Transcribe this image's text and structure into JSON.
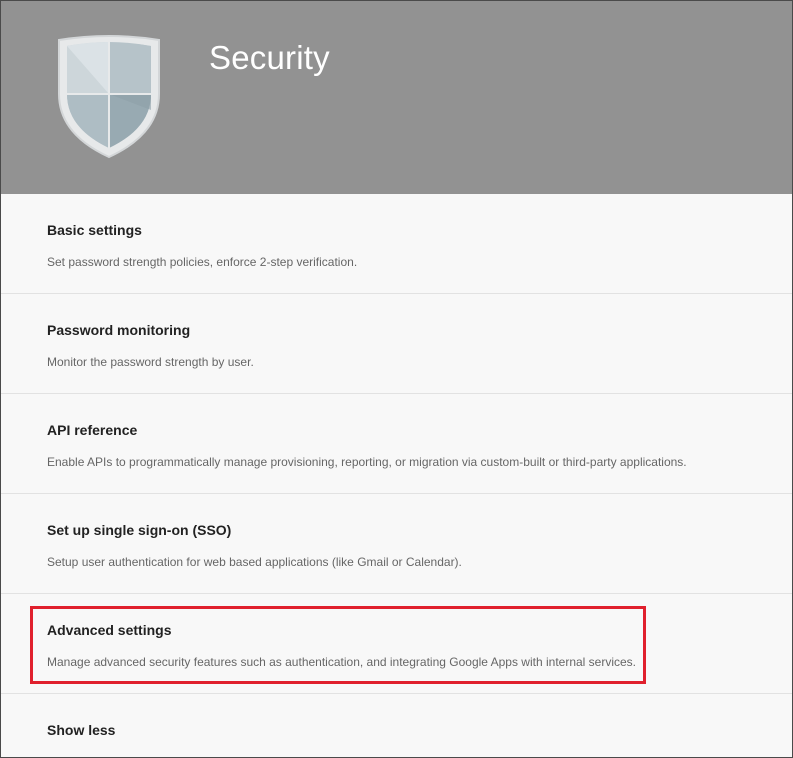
{
  "header": {
    "title": "Security",
    "icon": "shield-icon",
    "background_color": "#929292"
  },
  "items": [
    {
      "title": "Basic settings",
      "description": "Set password strength policies, enforce 2-step verification."
    },
    {
      "title": "Password monitoring",
      "description": "Monitor the password strength by user."
    },
    {
      "title": "API reference",
      "description": "Enable APIs to programmatically manage provisioning, reporting, or migration via custom-built or third-party applications."
    },
    {
      "title": "Set up single sign-on (SSO)",
      "description": "Setup user authentication for web based applications (like Gmail or Calendar)."
    },
    {
      "title": "Advanced settings",
      "description": "Manage advanced security features such as authentication, and integrating Google Apps with internal services."
    }
  ],
  "show_less_label": "Show less",
  "highlight_color": "#e0202d"
}
